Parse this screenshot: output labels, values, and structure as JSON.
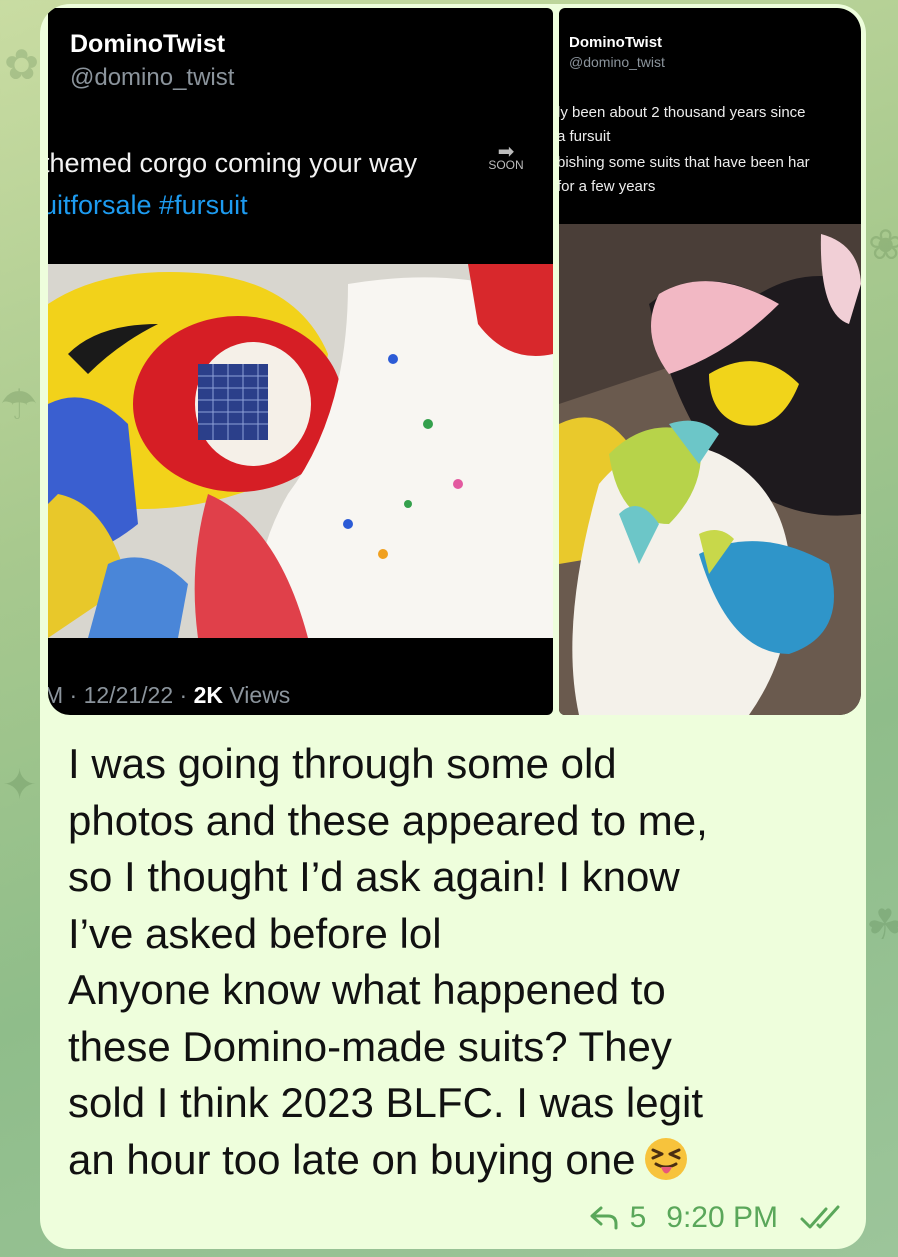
{
  "tweet1": {
    "display_name": "DominoTwist",
    "handle": "@domino_twist",
    "text": "themed corgo coming your way",
    "soon_label": "SOON",
    "hashtags": "uitforsale #fursuit",
    "meta_prefix": "M · 12/21/22 · ",
    "views_count": "2K",
    "views_label": " Views"
  },
  "tweet2": {
    "display_name": "DominoTwist",
    "handle": "@domino_twist",
    "lines": [
      "ly been about 2 thousand years since",
      "a fursuit",
      "bishing some suits that have been har",
      " for a few years"
    ]
  },
  "message": {
    "text": "I was going through some old\nphotos and these appeared to me,\nso I thought I’d ask again! I know\nI’ve asked before lol\nAnyone know what happened to\nthese Domino-made suits? They\nsold I think 2023 BLFC. I was legit\nan hour too late on buying one",
    "emoji": "squinting-face-with-tongue",
    "reply_count": "5",
    "time": "9:20 PM",
    "status": "read"
  },
  "colors": {
    "bubble": "#eefedc",
    "meta": "#5aa75a",
    "link": "#1d9bf0"
  }
}
